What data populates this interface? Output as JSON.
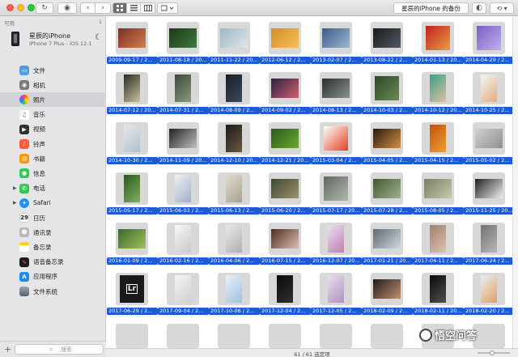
{
  "toolbar": {
    "device_backup_label": "星辰的iPhone 的备份",
    "refresh_icon": "refresh-icon",
    "view_modes": [
      "grid",
      "list",
      "columns"
    ]
  },
  "sidebar": {
    "section_label": "可用",
    "section_count": "1",
    "device_name": "星辰的iPhone",
    "device_sub": "iPhone 7 Plus - iOS 12.1",
    "items": [
      {
        "label": "文件",
        "icon": "folder-icon",
        "color": "#4a9fe8"
      },
      {
        "label": "相机",
        "icon": "camera-icon",
        "color": "#7a7a7a"
      },
      {
        "label": "照片",
        "icon": "photos-icon",
        "color": "#ffffff"
      },
      {
        "label": "音乐",
        "icon": "music-icon",
        "color": "#ffffff"
      },
      {
        "label": "视频",
        "icon": "video-icon",
        "color": "#2f2f2f"
      },
      {
        "label": "铃声",
        "icon": "bell-icon",
        "color": "#ff5d3a"
      },
      {
        "label": "书籍",
        "icon": "books-icon",
        "color": "#ff9500"
      },
      {
        "label": "信息",
        "icon": "messages-icon",
        "color": "#34c759"
      },
      {
        "label": "电话",
        "icon": "phone-icon",
        "color": "#34c759"
      },
      {
        "label": "Safari",
        "icon": "safari-icon",
        "color": "#1e90ff"
      },
      {
        "label": "日历",
        "icon": "calendar-icon",
        "color": "#ffffff"
      },
      {
        "label": "通讯录",
        "icon": "contacts-icon",
        "color": "#b8b8b8"
      },
      {
        "label": "备忘录",
        "icon": "notes-icon",
        "color": "#ffd60a"
      },
      {
        "label": "语音备忘录",
        "icon": "voice-memo-icon",
        "color": "#1c1c1e"
      },
      {
        "label": "应用程序",
        "icon": "appstore-icon",
        "color": "#1c8cf5"
      },
      {
        "label": "文件系统",
        "icon": "filesystem-icon",
        "color": "#d9d9d9"
      }
    ],
    "calendar_day": "29",
    "search_placeholder": "搜索"
  },
  "photos": [
    {
      "label": "2009-09-17 / 2...",
      "c1": "#7b3020",
      "c2": "#d08050",
      "shape": "land"
    },
    {
      "label": "2011-08-18 / 20...",
      "c1": "#1d3a1a",
      "c2": "#3e7a3c",
      "shape": "land"
    },
    {
      "label": "2011-11-22 / 20...",
      "c1": "#9db6c4",
      "c2": "#dfe6ea",
      "shape": "land"
    },
    {
      "label": "2012-06-12 / 2...",
      "c1": "#d88b24",
      "c2": "#f2c25a",
      "shape": "land"
    },
    {
      "label": "2013-02-07 / 2...",
      "c1": "#3a5b8a",
      "c2": "#9fb6d3",
      "shape": "land"
    },
    {
      "label": "2013-08-22 / 2...",
      "c1": "#1a1a1a",
      "c2": "#505a66",
      "shape": "land"
    },
    {
      "label": "2014-01-13 / 20...",
      "c1": "#c02020",
      "c2": "#e8a040",
      "shape": "square"
    },
    {
      "label": "2014-04-29 / 2...",
      "c1": "#7a5fc8",
      "c2": "#c0b0e8",
      "shape": "square"
    },
    {
      "label": "2014-07-12 / 20...",
      "c1": "#2a2a20",
      "c2": "#c8c0a0",
      "shape": "port"
    },
    {
      "label": "2014-07-31 / 2...",
      "c1": "#3a4a3a",
      "c2": "#8a9a80",
      "shape": "port"
    },
    {
      "label": "2014-08-09 / 2...",
      "c1": "#15202a",
      "c2": "#3a4a58",
      "shape": "port"
    },
    {
      "label": "2014-09-02 / 2...",
      "c1": "#2a2040",
      "c2": "#d06070",
      "shape": "land"
    },
    {
      "label": "2014-08-13 / 2...",
      "c1": "#2a3030",
      "c2": "#8a9090",
      "shape": "land"
    },
    {
      "label": "2014-10-03 / 2...",
      "c1": "#2a4a2a",
      "c2": "#6a8a50",
      "shape": "square"
    },
    {
      "label": "2014-10-12 / 20...",
      "c1": "#3aa08a",
      "c2": "#e0c0a0",
      "shape": "port"
    },
    {
      "label": "2014-10-25 / 2...",
      "c1": "#f4f4f4",
      "c2": "#e0b080",
      "shape": "port"
    },
    {
      "label": "2014-10-30 / 2...",
      "c1": "#e8e8e8",
      "c2": "#b0c0d0",
      "shape": "port"
    },
    {
      "label": "2014-11-09 / 20...",
      "c1": "#202020",
      "c2": "#c0c0c0",
      "shape": "land"
    },
    {
      "label": "2014-12-10 / 20...",
      "c1": "#1a1a1a",
      "c2": "#6a5a40",
      "shape": "port"
    },
    {
      "label": "2014-12-21 / 20...",
      "c1": "#2a5a1a",
      "c2": "#6aaa30",
      "shape": "land"
    },
    {
      "label": "2015-03-04 / 2...",
      "c1": "#ffffff",
      "c2": "#e04020",
      "shape": "square"
    },
    {
      "label": "2015-04-05 / 2...",
      "c1": "#2a1a10",
      "c2": "#d09040",
      "shape": "land"
    },
    {
      "label": "2015-04-15 / 2...",
      "c1": "#c05010",
      "c2": "#f0a030",
      "shape": "port"
    },
    {
      "label": "2015-05-02 / 2...",
      "c1": "#d0d0d0",
      "c2": "#909090",
      "shape": "land"
    },
    {
      "label": "2015-05-17 / 2...",
      "c1": "#2a5a20",
      "c2": "#80b060",
      "shape": "port"
    },
    {
      "label": "2015-06-03 / 2...",
      "c1": "#f0f0f0",
      "c2": "#a0b0c8",
      "shape": "port"
    },
    {
      "label": "2015-06-13 / 2...",
      "c1": "#e0dcd0",
      "c2": "#a8a090",
      "shape": "port"
    },
    {
      "label": "2015-06-20 / 2...",
      "c1": "#3a4a30",
      "c2": "#a09070",
      "shape": "land"
    },
    {
      "label": "2015-07-17 / 20...",
      "c1": "#606860",
      "c2": "#b0b8b0",
      "shape": "square"
    },
    {
      "label": "2015-07-28 / 2...",
      "c1": "#405a30",
      "c2": "#a0b090",
      "shape": "land"
    },
    {
      "label": "2015-08-05 / 2...",
      "c1": "#7a8060",
      "c2": "#c8c8b0",
      "shape": "land"
    },
    {
      "label": "2015-11-25 / 20...",
      "c1": "#202020",
      "c2": "#f0f0f0",
      "shape": "land"
    },
    {
      "label": "2016-01-09 / 2...",
      "c1": "#3a6a2a",
      "c2": "#a0c060",
      "shape": "land"
    },
    {
      "label": "2016-02-16 / 2...",
      "c1": "#f8f8f8",
      "c2": "#c8c8c8",
      "shape": "port"
    },
    {
      "label": "2016-04-06 / 2...",
      "c1": "#e8e8e8",
      "c2": "#b0b0b0",
      "shape": "port"
    },
    {
      "label": "2016-07-15 / 2...",
      "c1": "#502a20",
      "c2": "#d8c0b0",
      "shape": "land"
    },
    {
      "label": "2016-12-07 / 20...",
      "c1": "#e8e0f0",
      "c2": "#c080b0",
      "shape": "port"
    },
    {
      "label": "2017-01-21 / 20...",
      "c1": "#606a70",
      "c2": "#d0d8dc",
      "shape": "land"
    },
    {
      "label": "2017-04-11 / 2...",
      "c1": "#a08070",
      "c2": "#e0c0b0",
      "shape": "port"
    },
    {
      "label": "2017-06-24 / 2...",
      "c1": "#707070",
      "c2": "#b8b8b8",
      "shape": "port"
    },
    {
      "label": "2017-06-29 / 2...",
      "c1": "#1a1a1a",
      "c2": "#2a2a2a",
      "shape": "lr"
    },
    {
      "label": "2017-09-04 / 2...",
      "c1": "#f4f4f4",
      "c2": "#d0d0d0",
      "shape": "port"
    },
    {
      "label": "2017-10-06 / 2...",
      "c1": "#e8f0f8",
      "c2": "#a0c0e0",
      "shape": "port"
    },
    {
      "label": "2017-12-04 / 2...",
      "c1": "#0a0a0a",
      "c2": "#303030",
      "shape": "port"
    },
    {
      "label": "2017-12-05 / 2...",
      "c1": "#e8e0f0",
      "c2": "#b090c0",
      "shape": "port"
    },
    {
      "label": "2018-02-09 / 2...",
      "c1": "#201a1a",
      "c2": "#c09070",
      "shape": "land"
    },
    {
      "label": "2018-02-11 / 20...",
      "c1": "#0a0a0a",
      "c2": "#505050",
      "shape": "port"
    },
    {
      "label": "2018-02-20 / 2...",
      "c1": "#e8f0f8",
      "c2": "#e0a060",
      "shape": "port"
    }
  ],
  "status": {
    "text": "61 / 61 选定项",
    "zoom": 0.45
  },
  "watermark": {
    "text": "悟空问答"
  }
}
